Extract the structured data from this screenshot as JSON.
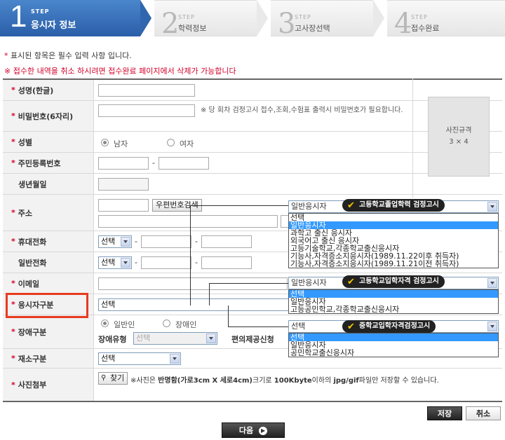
{
  "steps": [
    {
      "num": "1",
      "label": "STEP",
      "title": "응시자 정보"
    },
    {
      "num": "2",
      "label": "STEP",
      "title": "학력정보"
    },
    {
      "num": "3",
      "label": "STEP",
      "title": "고사장선택"
    },
    {
      "num": "4",
      "label": "STEP",
      "title": "접수완료"
    }
  ],
  "notes": {
    "required": "표시된 항목은 필수 입력 사항 입니다.",
    "required_star": "*",
    "cancel_notice": "※ 접수한 내역을 취소 하시려면 접수완료 페이지에서 삭제가 가능합니다"
  },
  "form": {
    "star": "*",
    "name_label": "성명(한글)",
    "password_label": "비밀번호(6자리)",
    "password_hint": "※ 당 회차 검정고시 접수,조회,수험표 출력시 비밀번호가 필요합니다.",
    "gender_label": "성별",
    "gender_male": "남자",
    "gender_female": "여자",
    "rrn_label": "주민등록번호",
    "dash": "-",
    "birth_label": "생년월일",
    "address_label": "주소",
    "zip_search_button": "우편번호검색",
    "mobile_label": "휴대전화",
    "phone_label": "일반전화",
    "email_label": "이메일",
    "applicant_type_label": "응시자구분",
    "disability_label": "장애구분",
    "disability_general": "일반인",
    "disability_disabled": "장애인",
    "disability_type_label": "장애유형",
    "convenience_label": "편의제공신청",
    "residence_label": "재소구분",
    "photo_label": "사진첨부",
    "find_button": "찾기",
    "photo_hint_a": "※사진은 ",
    "photo_hint_b": "반명함(가로3cm X 세로4cm)",
    "photo_hint_c": "크기로 ",
    "photo_hint_d": "100Kbyte",
    "photo_hint_e": "이하의 ",
    "photo_hint_f": "jpg/gif",
    "photo_hint_g": "파일만 저장할 수 있습니다.",
    "select_placeholder": "선택"
  },
  "photo_box": {
    "title": "사진규격",
    "size": "3 × 4"
  },
  "dropdowns": {
    "high_school": {
      "badge": "고등학교졸업학력 검정고시",
      "current": "일반응시자",
      "options": [
        "선택",
        "일반응시자",
        "과학고 출신 응시자",
        "외국어고 출신 응시자",
        "고등기술학교,각종학교출신응시자",
        "기능사,자격증소지응시자(1989.11.22이후 취득자)",
        "기능사,자격증소지응시자(1989.11.21이전 취득자)"
      ],
      "selected_index": 1
    },
    "middle_school": {
      "badge": "고등학교입학자격 검정고시",
      "current": "일반응시자",
      "options": [
        "선택",
        "일반응시자",
        "고등공민학교,각종학교출신응시자"
      ],
      "selected_index": 0
    },
    "elementary": {
      "badge": "중학교입학자격검정고시",
      "current": "선택",
      "options": [
        "선택",
        "일반응시자",
        "공민학교출신응시자"
      ],
      "selected_index": 0
    }
  },
  "buttons": {
    "save": "저장",
    "cancel": "취소",
    "next": "다음",
    "next_arrow": "▶"
  }
}
